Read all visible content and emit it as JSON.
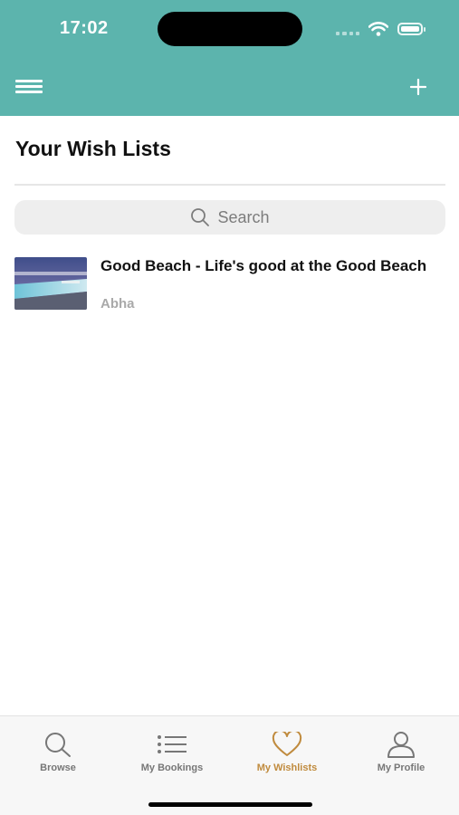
{
  "status_bar": {
    "time": "17:02"
  },
  "header": {
    "menu_icon": "hamburger-icon",
    "add_icon": "plus-icon"
  },
  "page": {
    "title": "Your Wish Lists"
  },
  "search": {
    "placeholder": "Search",
    "icon": "search-icon"
  },
  "wishlist": [
    {
      "title": "Good Beach - Life's good at the Good Beach",
      "location": "Abha"
    }
  ],
  "tabs": [
    {
      "label": "Browse",
      "icon": "search-icon",
      "active": false
    },
    {
      "label": "My Bookings",
      "icon": "list-icon",
      "active": false
    },
    {
      "label": "My Wishlists",
      "icon": "heart-icon",
      "active": true
    },
    {
      "label": "My Profile",
      "icon": "person-icon",
      "active": false
    }
  ],
  "colors": {
    "header": "#5cb4ad",
    "active_tab": "#c08b3e",
    "inactive_tab": "#777777"
  }
}
